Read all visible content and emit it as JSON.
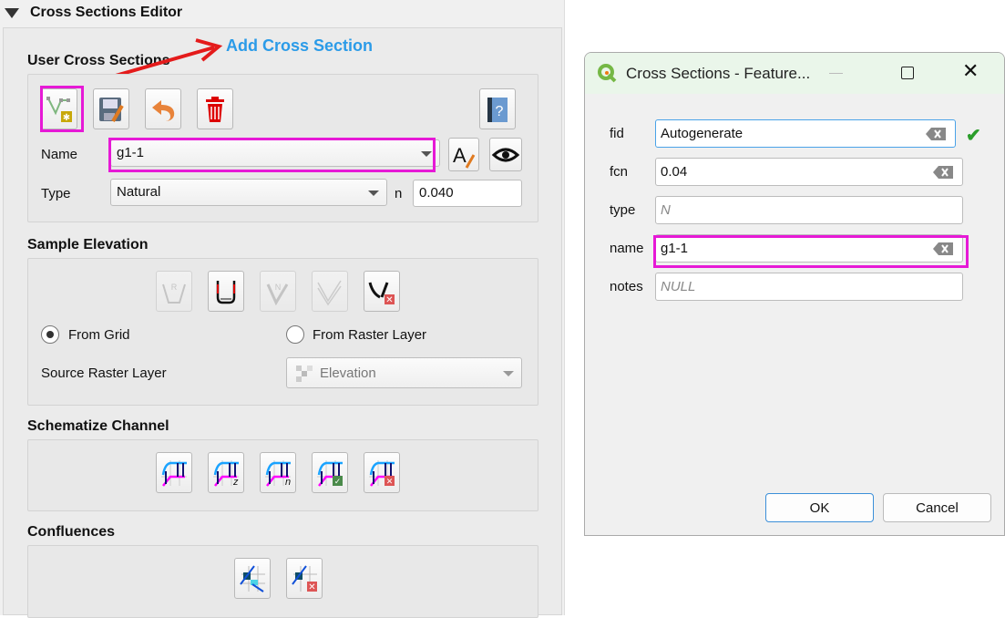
{
  "editor": {
    "title": "Cross Sections Editor",
    "annotation": "Add Cross Section",
    "user_cross_sections": {
      "heading": "User Cross Sections",
      "name_label": "Name",
      "name_value": "g1-1",
      "type_label": "Type",
      "type_value": "Natural",
      "n_label": "n",
      "n_value": "0.040"
    },
    "sample_elevation": {
      "heading": "Sample Elevation",
      "from_grid": "From Grid",
      "from_raster": "From Raster Layer",
      "source_label": "Source Raster Layer",
      "source_value": "Elevation",
      "selected": "From Grid"
    },
    "schematize": {
      "heading": "Schematize Channel"
    },
    "confluences": {
      "heading": "Confluences"
    }
  },
  "dialog": {
    "title": "Cross Sections - Feature...",
    "fields": [
      {
        "label": "fid",
        "value": "Autogenerate"
      },
      {
        "label": "fcn",
        "value": "0.04"
      },
      {
        "label": "type",
        "placeholder": "N"
      },
      {
        "label": "name",
        "value": "g1-1"
      },
      {
        "label": "notes",
        "placeholder": "NULL"
      }
    ],
    "ok": "OK",
    "cancel": "Cancel"
  },
  "colors": {
    "highlight": "#e619d6",
    "annotation": "#2b9be8",
    "arrow": "#e41b1b"
  }
}
